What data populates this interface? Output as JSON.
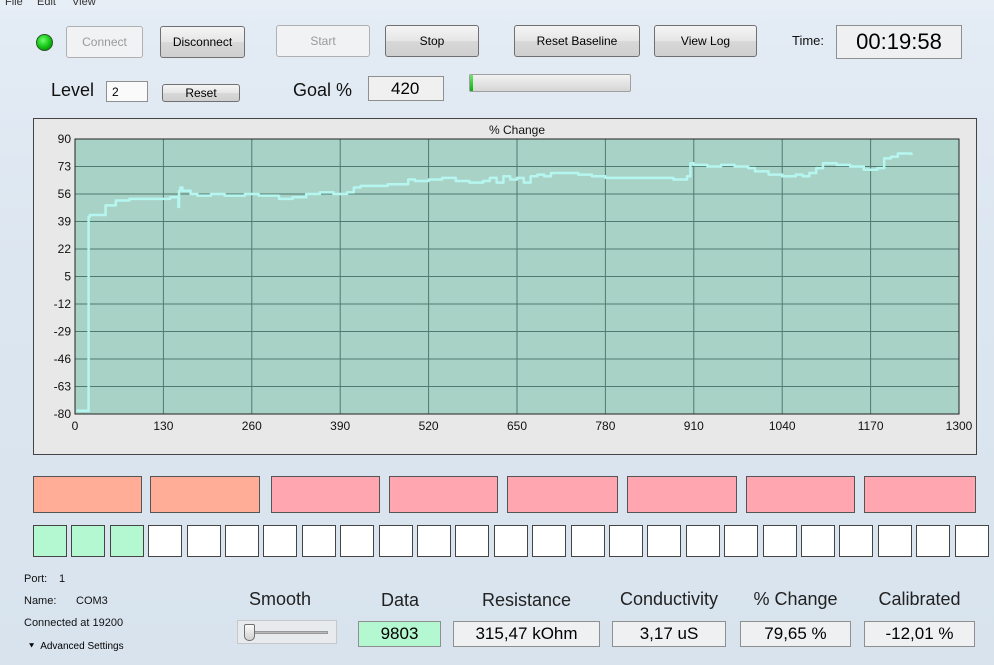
{
  "menu": {
    "items": [
      "File",
      "Edit",
      "View"
    ]
  },
  "toolbar": {
    "connect": "Connect",
    "disconnect": "Disconnect",
    "start": "Start",
    "stop": "Stop",
    "reset_baseline": "Reset Baseline",
    "view_log": "View Log",
    "time_label": "Time:",
    "time_value": "00:19:58"
  },
  "status": {
    "connected_led_color": "#10c010"
  },
  "level": {
    "label": "Level",
    "value": "2",
    "reset": "Reset"
  },
  "goal": {
    "label": "Goal %",
    "value": "420",
    "progress_fraction": 0.02
  },
  "chart_data": {
    "type": "line",
    "title": "% Change",
    "xlabel": "",
    "ylabel": "",
    "xlim": [
      0,
      1300
    ],
    "ylim": [
      -80,
      90
    ],
    "xticks": [
      0,
      130,
      260,
      390,
      520,
      650,
      780,
      910,
      1040,
      1170,
      1300
    ],
    "yticks": [
      90,
      73,
      56,
      39,
      22,
      5,
      -12,
      -29,
      -46,
      -63,
      -80
    ],
    "grid": true,
    "line_color": "#b6f6f0",
    "plot_bg": "#a9d2c7",
    "series": [
      {
        "name": "",
        "x": [
          2,
          20,
          20,
          22,
          40,
          45,
          60,
          80,
          100,
          120,
          140,
          152,
          153,
          155,
          158,
          162,
          170,
          180,
          200,
          220,
          250,
          270,
          300,
          320,
          340,
          360,
          380,
          400,
          410,
          420,
          440,
          460,
          480,
          490,
          500,
          520,
          540,
          560,
          580,
          600,
          610,
          620,
          630,
          640,
          650,
          660,
          670,
          680,
          690,
          700,
          720,
          740,
          760,
          780,
          800,
          820,
          840,
          860,
          880,
          900,
          905,
          910,
          930,
          950,
          970,
          990,
          1000,
          1020,
          1040,
          1060,
          1070,
          1080,
          1090,
          1100,
          1120,
          1140,
          1160,
          1170,
          1180,
          1190,
          1200,
          1210,
          1230
        ],
        "y": [
          -78,
          -78,
          42,
          43,
          43,
          49,
          52,
          53,
          53,
          53,
          54,
          48,
          58,
          60,
          58,
          58,
          56,
          55,
          56,
          55,
          56,
          55,
          53,
          54,
          56,
          57,
          56,
          57,
          60,
          61,
          61,
          62,
          62,
          65,
          64,
          65,
          66,
          64,
          63,
          64,
          66,
          63,
          67,
          65,
          66,
          63,
          67,
          68,
          67,
          69,
          69,
          68,
          67,
          66,
          66,
          66,
          66,
          66,
          65,
          67,
          75,
          74,
          73,
          74,
          73,
          72,
          70,
          68,
          67,
          68,
          67,
          69,
          72,
          75,
          74,
          73,
          71,
          71,
          72,
          78,
          79,
          81,
          80
        ]
      }
    ]
  },
  "zones": [
    {
      "color": "#ffad96"
    },
    {
      "color": "#ffad96"
    },
    {
      "color": "#ffa6b0"
    },
    {
      "color": "#ffa6b0"
    },
    {
      "color": "#ffa6b0"
    },
    {
      "color": "#ffa6b0"
    },
    {
      "color": "#ffa6b0"
    },
    {
      "color": "#ffa6b0"
    }
  ],
  "level_squares": {
    "count": 25,
    "filled": 3,
    "filled_color": "#b3f8d0"
  },
  "port_info": {
    "port_label": "Port:",
    "port_value": "1",
    "name_label": "Name:",
    "name_value": "COM3",
    "connected_text": "Connected at 19200",
    "advanced_settings": "Advanced Settings"
  },
  "readouts": {
    "smooth_label": "Smooth",
    "smooth_level": 0.0,
    "data_label": "Data",
    "data_value": "9803",
    "data_bg": "#b3f8d0",
    "resistance_label": "Resistance",
    "resistance_value": "315,47 kOhm",
    "conductivity_label": "Conductivity",
    "conductivity_value": "3,17 uS",
    "change_label": "% Change",
    "change_value": "79,65 %",
    "calibrated_label": "Calibrated",
    "calibrated_value": "-12,01 %"
  }
}
